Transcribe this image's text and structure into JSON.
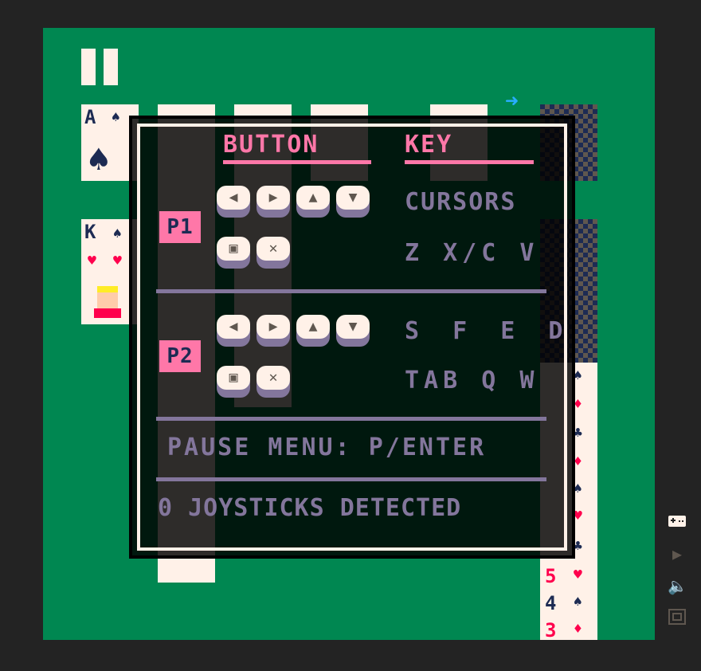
{
  "help": {
    "button_header": "BUTTON",
    "key_header": "KEY",
    "p1": {
      "badge": "P1",
      "cursor_keys": "CURSORS",
      "action_keys": "Z X/C V",
      "dpad_glyphs": [
        "◀",
        "▶",
        "▲",
        "▼"
      ],
      "action_glyphs": [
        "▣",
        "✕"
      ]
    },
    "p2": {
      "badge": "P2",
      "cursor_keys": "S F E D",
      "action_keys": "TAB Q W",
      "dpad_glyphs": [
        "◀",
        "▶",
        "▲",
        "▼"
      ],
      "action_glyphs": [
        "▣",
        "✕"
      ]
    },
    "pause_text": "PAUSE MENU: P/ENTER",
    "joystick_text": "0 JOYSTICKS DETECTED"
  },
  "game": {
    "cards": {
      "ace_spades": {
        "rank": "A",
        "suit": "♠"
      },
      "king_hearts": {
        "rank": "K",
        "suits": [
          "♠",
          "♥",
          "♥"
        ]
      },
      "column_ranks": [
        "5",
        "4",
        "3"
      ]
    }
  },
  "sidebar": {
    "icons": [
      "gamepad-icon",
      "play-icon",
      "volume-icon",
      "fullscreen-icon"
    ]
  },
  "colors": {
    "felt": "#008751",
    "dialog_accent": "#ff77a8",
    "dialog_text": "#83769c",
    "card_face": "#fff1e8",
    "card_back": "#1d2b53"
  }
}
